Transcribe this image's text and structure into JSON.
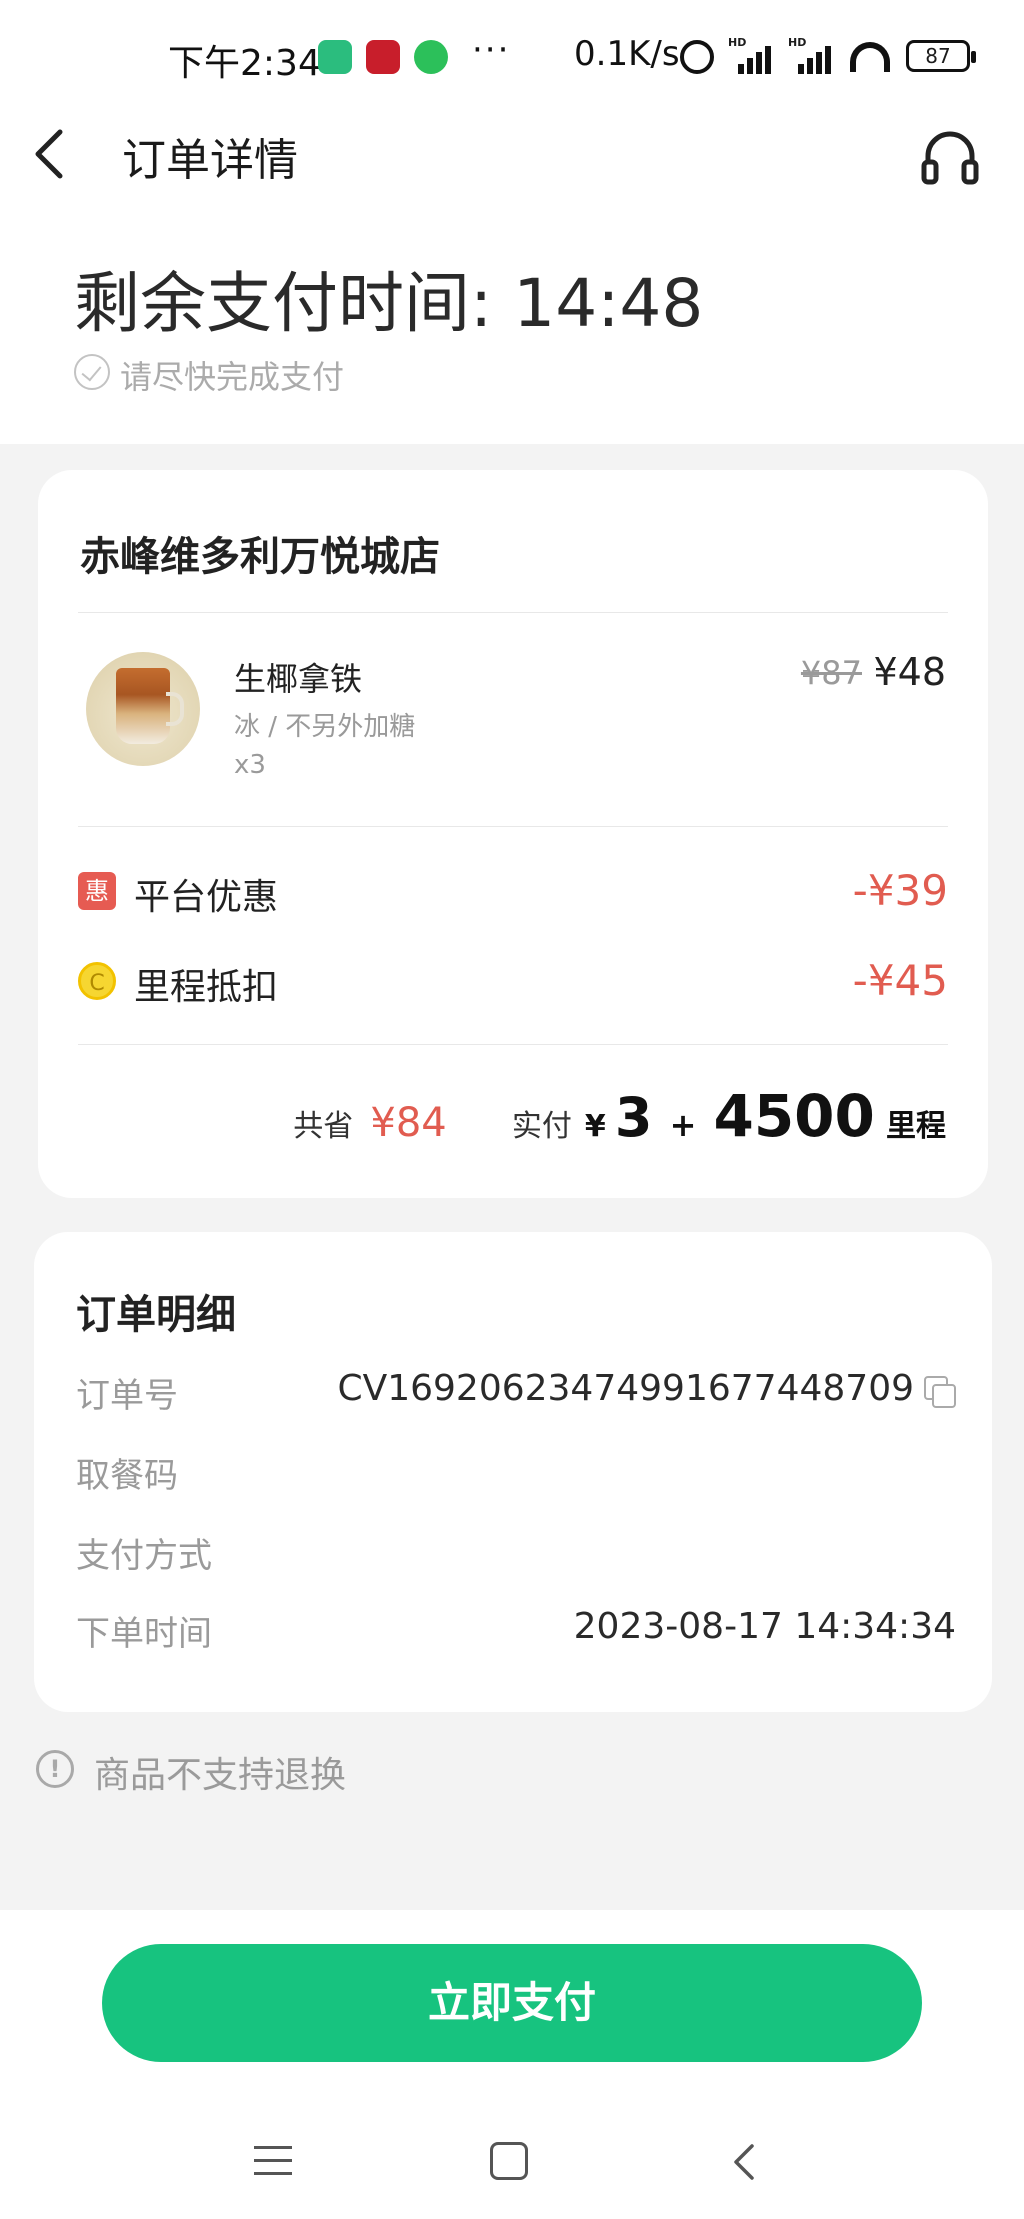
{
  "status_bar": {
    "time": "下午2:34",
    "more": "···",
    "net_speed": "0.1K/s",
    "signal_tag": "HD",
    "battery": "87"
  },
  "header": {
    "title": "订单详情",
    "back_icon": "chevron-left-icon",
    "service_icon": "headset-icon"
  },
  "countdown": {
    "label": "剩余支付时间: 14:48",
    "hint": "请尽快完成支付"
  },
  "store": {
    "name": "赤峰维多利万悦城店",
    "product": {
      "name": "生椰拿铁",
      "spec": "冰 / 不另外加糖",
      "qty": "x3",
      "original_price": "¥87",
      "price": "¥48"
    },
    "discounts": [
      {
        "icon_text": "惠",
        "label": "平台优惠",
        "amount": "-¥39"
      },
      {
        "icon_text": "C",
        "label": "里程抵扣",
        "amount": "-¥45"
      }
    ],
    "total": {
      "saved_label": "共省",
      "saved_amount": "¥84",
      "paid_label": "实付",
      "currency": "¥",
      "cash": "3",
      "plus": "+",
      "miles": "4500",
      "miles_unit": "里程"
    }
  },
  "detail": {
    "title": "订单明细",
    "rows": [
      {
        "label": "订单号",
        "value": "CV16920623474991677448709"
      },
      {
        "label": "取餐码",
        "value": ""
      },
      {
        "label": "支付方式",
        "value": ""
      },
      {
        "label": "下单时间",
        "value": "2023-08-17 14:34:34"
      }
    ]
  },
  "notice": {
    "icon": "!",
    "text": "商品不支持退换"
  },
  "pay_button": "立即支付",
  "colors": {
    "accent_green": "#17c37f",
    "discount_red": "#e15c50"
  }
}
